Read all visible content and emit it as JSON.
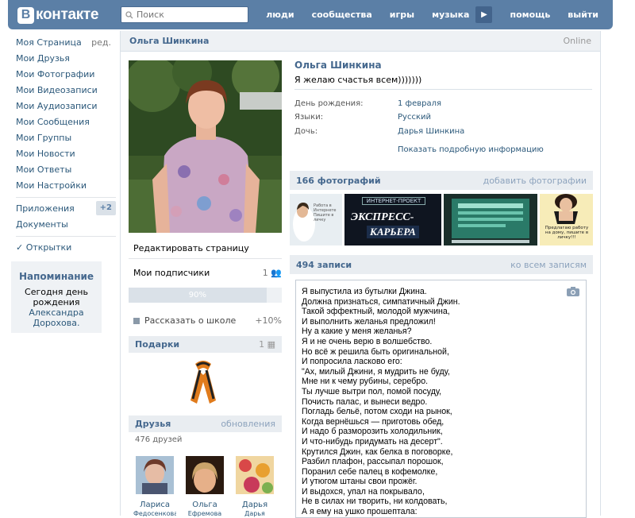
{
  "header": {
    "logo_letter": "В",
    "logo_text": "контакте",
    "search_placeholder": "Поиск",
    "nav": [
      "люди",
      "сообщества",
      "игры",
      "музыка",
      "помощь",
      "выйти"
    ],
    "accent": "#5b7fa6"
  },
  "leftnav": {
    "items": [
      "Моя Страница",
      "Мои Друзья",
      "Мои Фотографии",
      "Мои Видеозаписи",
      "Мои Аудиозаписи",
      "Мои Сообщения",
      "Мои Группы",
      "Мои Новости",
      "Мои Ответы",
      "Мои Настройки"
    ],
    "edit": "ред.",
    "apps": "Приложения",
    "apps_badge": "+2",
    "docs": "Документы",
    "cards": "✓ Открытки"
  },
  "reminder": {
    "title": "Напоминание",
    "today": "Сегодня",
    "bday": "день рождения",
    "person": "Александра Дорохова."
  },
  "profile": {
    "name": "Ольга Шинкина",
    "online": "Online",
    "status": "Я желаю счастья всем)))))))",
    "info": [
      {
        "k": "День рождения:",
        "v": "1 февраля"
      },
      {
        "k": "Языки:",
        "v": "Русский"
      },
      {
        "k": "Дочь:",
        "v": "Дарья Шинкина"
      }
    ],
    "more": "Показать подробную информацию"
  },
  "left": {
    "edit": "Редактировать страницу",
    "subs": "Мои подписчики",
    "subs_count": "1",
    "progress": "90%",
    "progress_value": 0.9,
    "school": "Рассказать о школе",
    "school_bonus": "+10%",
    "gifts": "Подарки",
    "gifts_count": "1",
    "friends": "Друзья",
    "friends_updates": "обновления",
    "friends_total": "476 друзей",
    "friend_list": [
      {
        "first": "Лариса",
        "last": "Федосенкова"
      },
      {
        "first": "Ольга",
        "last": "Ефремова"
      },
      {
        "first": "Дарья",
        "last": "Дарья"
      }
    ]
  },
  "photos": {
    "title": "166 фотографий",
    "add": "добавить фотографии"
  },
  "wall": {
    "title": "494 записи",
    "all": "ко всем записям",
    "post": [
      "Я выпустила из бутылки Джина.",
      "Должна признаться, симпатичный Джин.",
      "Такой эффектный, молодой мужчина,",
      "И выполнить желанья предложил!",
      "Ну а какие у меня желанья?",
      "Я и не очень верю в волшебство.",
      "Но всё ж решила быть оригинальной,",
      "И попросила ласково его:",
      "\"Ах, милый Джини, я мудрить не буду,",
      "Мне ни к чему рубины, серебро.",
      "Ты лучше вытри пол, помой посуду,",
      "Почисть палас, и вынеси ведро.",
      "Погладь бельё, потом сходи на рынок,",
      "Когда вернёшься — приготовь обед,",
      "И надо б разморозить холодильник,",
      "И что-нибудь придумать на десерт\".",
      "Крутился Джин, как белка в поговорке,",
      "Разбил плафон, рассыпал порошок,",
      "Поранил себе палец в кофемолке,",
      "И утюгом штаны свои прожёг.",
      "И выдохся, упал на покрывало,",
      "Не в силах ни творить, ни колдовать,",
      "А я ему на ушко прошептала:"
    ]
  },
  "thumb_texts": {
    "t1": "Работа в Интернете Пишите в личку",
    "t2a": "ИНТЕРНЕТ-ПРОЕКТ",
    "t2b": "ЭКСПРЕСС-",
    "t2c": "КАРЬЕРА",
    "t4": "Предлагаю работу на дому, пишите в личку!!!"
  }
}
